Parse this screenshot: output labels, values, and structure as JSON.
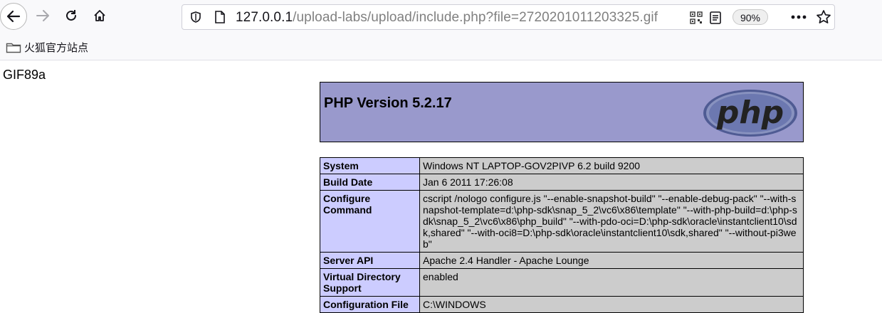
{
  "browser": {
    "url_host": "127.0.0.1",
    "url_path": "/upload-labs/upload/include.php?file=2720201011203325.gif",
    "zoom": "90%",
    "bookmark_label": "火狐官方站点"
  },
  "page": {
    "gif_text": "GIF89a",
    "php_version": "PHP Version 5.2.17",
    "logo_text": "php"
  },
  "info_rows": [
    {
      "key": "System",
      "value": "Windows NT LAPTOP-GOV2PIVP 6.2 build 9200"
    },
    {
      "key": "Build Date",
      "value": "Jan 6 2011 17:26:08"
    },
    {
      "key": "Configure Command",
      "value": "cscript /nologo configure.js \"--enable-snapshot-build\" \"--enable-debug-pack\" \"--with-snapshot-template=d:\\php-sdk\\snap_5_2\\vc6\\x86\\template\" \"--with-php-build=d:\\php-sdk\\snap_5_2\\vc6\\x86\\php_build\" \"--with-pdo-oci=D:\\php-sdk\\oracle\\instantclient10\\sdk,shared\" \"--with-oci8=D:\\php-sdk\\oracle\\instantclient10\\sdk,shared\" \"--without-pi3web\""
    },
    {
      "key": "Server API",
      "value": "Apache 2.4 Handler - Apache Lounge"
    },
    {
      "key": "Virtual Directory Support",
      "value": "enabled"
    },
    {
      "key": "Configuration File",
      "value": "C:\\WINDOWS"
    }
  ]
}
